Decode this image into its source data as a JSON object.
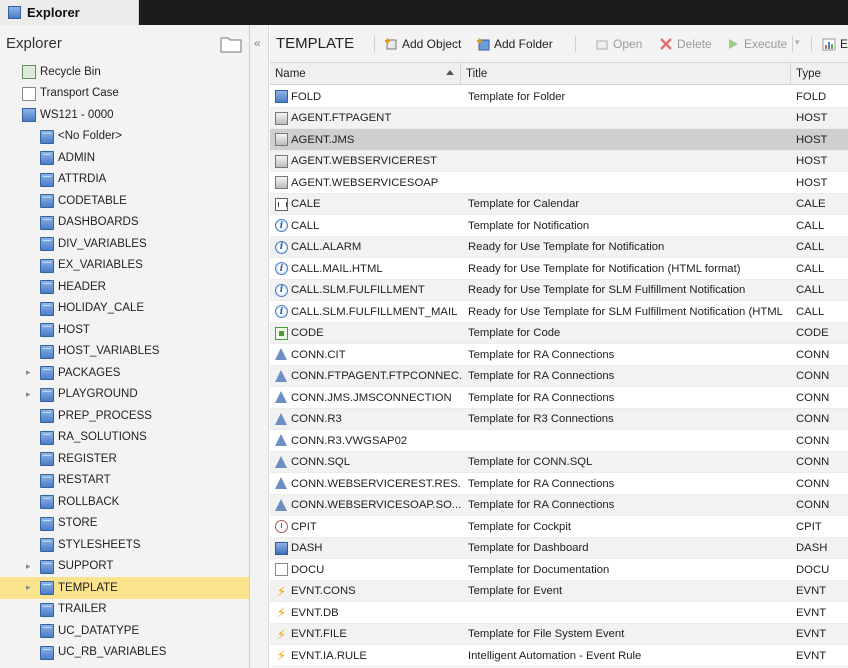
{
  "window": {
    "tab_title": "Explorer"
  },
  "explorer": {
    "title": "Explorer",
    "tree": [
      {
        "label": "Recycle Bin",
        "icon": "recycle-bin-icon",
        "level": 1,
        "expandable": false
      },
      {
        "label": "Transport Case",
        "icon": "transport-case-icon",
        "level": 1,
        "expandable": false
      },
      {
        "label": "WS121 - 0000",
        "icon": "client-icon",
        "level": 1,
        "expandable": false
      },
      {
        "label": "<No Folder>",
        "icon": "folder-icon",
        "level": 2,
        "expandable": false
      },
      {
        "label": "ADMIN",
        "icon": "folder-icon",
        "level": 2,
        "expandable": false
      },
      {
        "label": "ATTRDIA",
        "icon": "folder-icon",
        "level": 2,
        "expandable": false
      },
      {
        "label": "CODETABLE",
        "icon": "folder-icon",
        "level": 2,
        "expandable": false
      },
      {
        "label": "DASHBOARDS",
        "icon": "folder-icon",
        "level": 2,
        "expandable": false
      },
      {
        "label": "DIV_VARIABLES",
        "icon": "folder-icon",
        "level": 2,
        "expandable": false
      },
      {
        "label": "EX_VARIABLES",
        "icon": "folder-icon",
        "level": 2,
        "expandable": false
      },
      {
        "label": "HEADER",
        "icon": "folder-icon",
        "level": 2,
        "expandable": false
      },
      {
        "label": "HOLIDAY_CALE",
        "icon": "folder-icon",
        "level": 2,
        "expandable": false
      },
      {
        "label": "HOST",
        "icon": "folder-icon",
        "level": 2,
        "expandable": false
      },
      {
        "label": "HOST_VARIABLES",
        "icon": "folder-icon",
        "level": 2,
        "expandable": false
      },
      {
        "label": "PACKAGES",
        "icon": "folder-icon",
        "level": 2,
        "expandable": true
      },
      {
        "label": "PLAYGROUND",
        "icon": "folder-icon",
        "level": 2,
        "expandable": true
      },
      {
        "label": "PREP_PROCESS",
        "icon": "folder-icon",
        "level": 2,
        "expandable": false
      },
      {
        "label": "RA_SOLUTIONS",
        "icon": "folder-icon",
        "level": 2,
        "expandable": false
      },
      {
        "label": "REGISTER",
        "icon": "folder-icon",
        "level": 2,
        "expandable": false
      },
      {
        "label": "RESTART",
        "icon": "folder-icon",
        "level": 2,
        "expandable": false
      },
      {
        "label": "ROLLBACK",
        "icon": "folder-icon",
        "level": 2,
        "expandable": false
      },
      {
        "label": "STORE",
        "icon": "folder-icon",
        "level": 2,
        "expandable": false
      },
      {
        "label": "STYLESHEETS",
        "icon": "folder-icon",
        "level": 2,
        "expandable": false
      },
      {
        "label": "SUPPORT",
        "icon": "folder-icon",
        "level": 2,
        "expandable": true
      },
      {
        "label": "TEMPLATE",
        "icon": "folder-icon",
        "level": 2,
        "expandable": true,
        "selected": true
      },
      {
        "label": "TRAILER",
        "icon": "folder-icon",
        "level": 2,
        "expandable": false
      },
      {
        "label": "UC_DATATYPE",
        "icon": "folder-icon",
        "level": 2,
        "expandable": false
      },
      {
        "label": "UC_RB_VARIABLES",
        "icon": "folder-icon",
        "level": 2,
        "expandable": false
      }
    ]
  },
  "toolbar": {
    "title": "TEMPLATE",
    "add_object": "Add Object",
    "add_folder": "Add Folder",
    "open": "Open",
    "delete": "Delete",
    "execute": "Execute",
    "export": "Ex"
  },
  "table": {
    "columns": {
      "name": "Name",
      "title": "Title",
      "type": "Type"
    },
    "rows": [
      {
        "name": "FOLD",
        "title": "Template for Folder",
        "type": "FOLD",
        "icon": "fold"
      },
      {
        "name": "AGENT.FTPAGENT",
        "title": "",
        "type": "HOST",
        "icon": "host"
      },
      {
        "name": "AGENT.JMS",
        "title": "",
        "type": "HOST",
        "icon": "host",
        "selected": true
      },
      {
        "name": "AGENT.WEBSERVICEREST",
        "title": "",
        "type": "HOST",
        "icon": "host"
      },
      {
        "name": "AGENT.WEBSERVICESOAP",
        "title": "",
        "type": "HOST",
        "icon": "host"
      },
      {
        "name": "CALE",
        "title": "Template for Calendar",
        "type": "CALE",
        "icon": "cale"
      },
      {
        "name": "CALL",
        "title": "Template for Notification",
        "type": "CALL",
        "icon": "info"
      },
      {
        "name": "CALL.ALARM",
        "title": "Ready for Use Template for Notification",
        "type": "CALL",
        "icon": "info"
      },
      {
        "name": "CALL.MAIL.HTML",
        "title": "Ready for Use Template for Notification (HTML format)",
        "type": "CALL",
        "icon": "info"
      },
      {
        "name": "CALL.SLM.FULFILLMENT",
        "title": "Ready for Use Template for SLM Fulfillment Notification",
        "type": "CALL",
        "icon": "info"
      },
      {
        "name": "CALL.SLM.FULFILLMENT_MAIL",
        "title": "Ready for Use Template for SLM Fulfillment Notification (HTML ...",
        "type": "CALL",
        "icon": "info"
      },
      {
        "name": "CODE",
        "title": "Template for Code",
        "type": "CODE",
        "icon": "code"
      },
      {
        "name": "CONN.CIT",
        "title": "Template for RA Connections",
        "type": "CONN",
        "icon": "conn"
      },
      {
        "name": "CONN.FTPAGENT.FTPCONNEC...",
        "title": "Template for RA Connections",
        "type": "CONN",
        "icon": "conn"
      },
      {
        "name": "CONN.JMS.JMSCONNECTION",
        "title": "Template for RA Connections",
        "type": "CONN",
        "icon": "conn"
      },
      {
        "name": "CONN.R3",
        "title": "Template for R3 Connections",
        "type": "CONN",
        "icon": "conn"
      },
      {
        "name": "CONN.R3.VWGSAP02",
        "title": "",
        "type": "CONN",
        "icon": "conn"
      },
      {
        "name": "CONN.SQL",
        "title": "Template for CONN.SQL",
        "type": "CONN",
        "icon": "conn"
      },
      {
        "name": "CONN.WEBSERVICEREST.RES...",
        "title": "Template for RA Connections",
        "type": "CONN",
        "icon": "conn"
      },
      {
        "name": "CONN.WEBSERVICESOAP.SO...",
        "title": "Template for RA Connections",
        "type": "CONN",
        "icon": "conn"
      },
      {
        "name": "CPIT",
        "title": "Template for Cockpit",
        "type": "CPIT",
        "icon": "cpit"
      },
      {
        "name": "DASH",
        "title": "Template for Dashboard",
        "type": "DASH",
        "icon": "dash"
      },
      {
        "name": "DOCU",
        "title": "Template for Documentation",
        "type": "DOCU",
        "icon": "docu"
      },
      {
        "name": "EVNT.CONS",
        "title": "Template for Event",
        "type": "EVNT",
        "icon": "evnt"
      },
      {
        "name": "EVNT.DB",
        "title": "",
        "type": "EVNT",
        "icon": "evnt"
      },
      {
        "name": "EVNT.FILE",
        "title": "Template for File System Event",
        "type": "EVNT",
        "icon": "evnt"
      },
      {
        "name": "EVNT.IA.RULE",
        "title": "Intelligent Automation - Event Rule",
        "type": "EVNT",
        "icon": "evnt"
      }
    ]
  }
}
